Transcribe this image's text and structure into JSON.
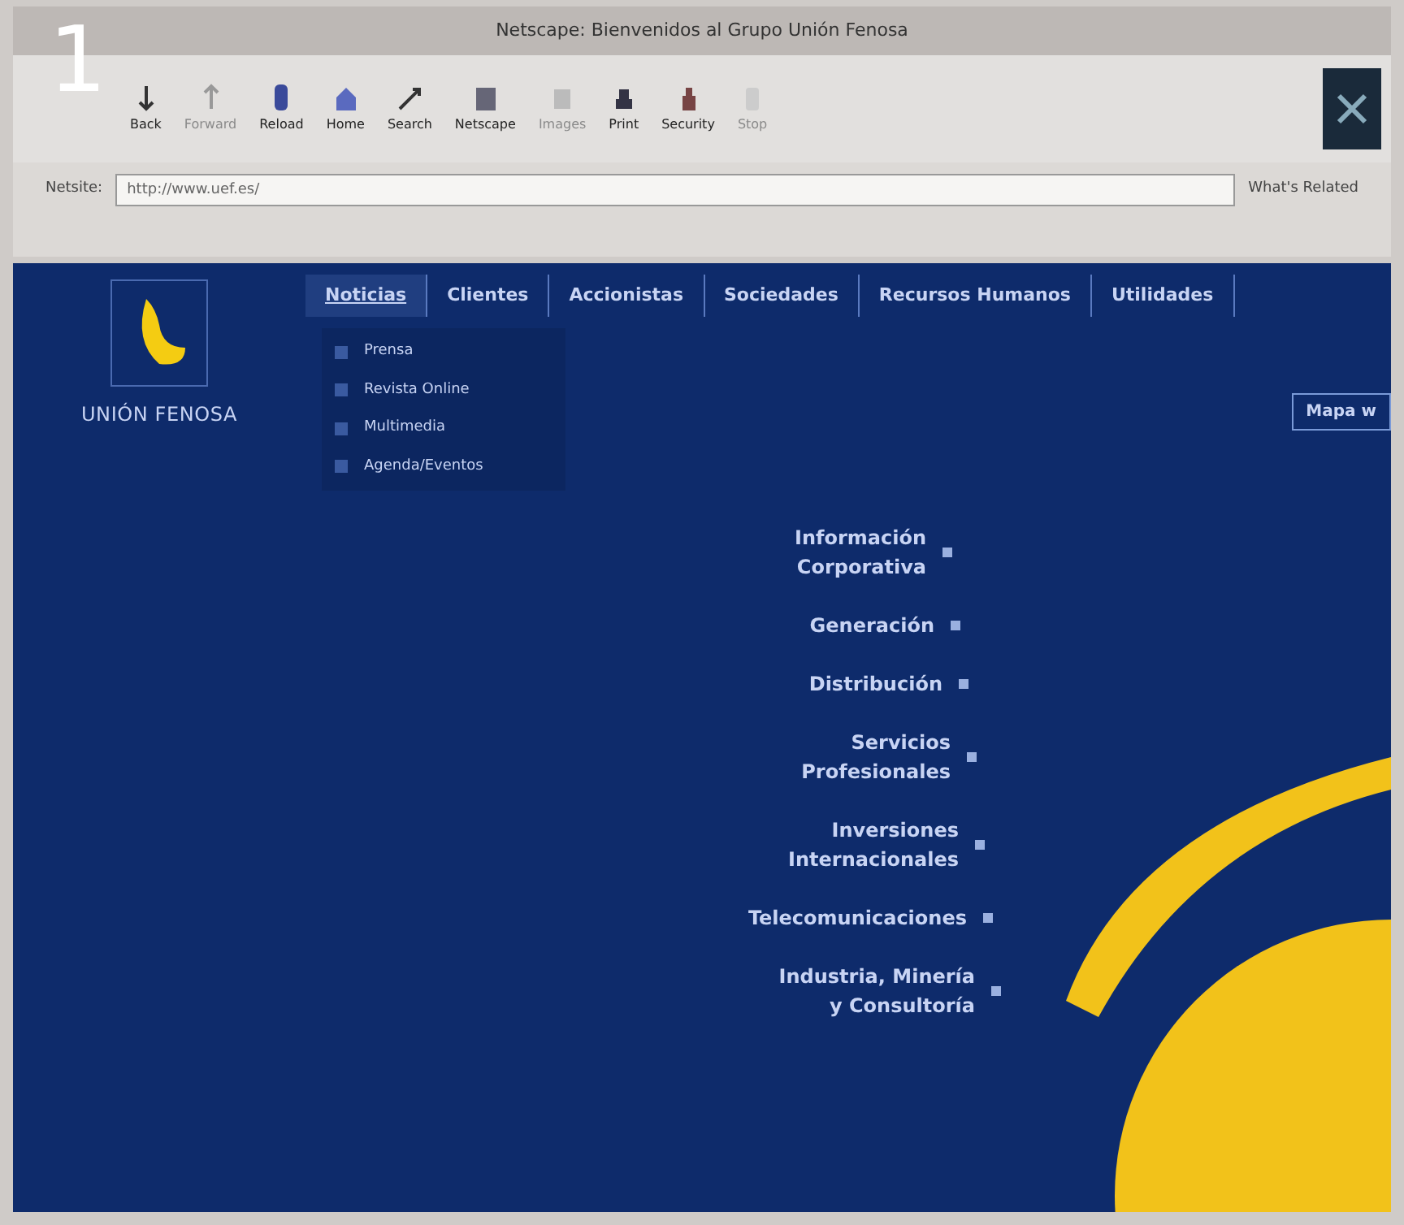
{
  "figure_label": "1",
  "window": {
    "title": "Netscape: Bienvenidos al Grupo Unión Fenosa"
  },
  "toolbar": [
    {
      "label": "Back",
      "disabled": false
    },
    {
      "label": "Forward",
      "disabled": true
    },
    {
      "label": "Reload",
      "disabled": false
    },
    {
      "label": "Home",
      "disabled": false
    },
    {
      "label": "Search",
      "disabled": false
    },
    {
      "label": "Netscape",
      "disabled": false
    },
    {
      "label": "Images",
      "disabled": true
    },
    {
      "label": "Print",
      "disabled": false
    },
    {
      "label": "Security",
      "disabled": false
    },
    {
      "label": "Stop",
      "disabled": true
    }
  ],
  "location": {
    "label": "Netsite:",
    "value": "http://www.uef.es/"
  },
  "whats_related": "What's Related",
  "site": {
    "logo_text": "UNIÓN FENOSA",
    "nav": [
      {
        "label": "Noticias",
        "selected": true
      },
      {
        "label": "Clientes",
        "selected": false
      },
      {
        "label": "Accionistas",
        "selected": false
      },
      {
        "label": "Sociedades",
        "selected": false
      },
      {
        "label": "Recursos Humanos",
        "selected": false
      },
      {
        "label": "Utilidades",
        "selected": false
      }
    ],
    "submenu": [
      "Prensa",
      "Revista Online",
      "Multimedia",
      "Agenda/Eventos"
    ],
    "side_button": "Mapa w",
    "sections": [
      [
        "Información",
        "Corporativa"
      ],
      [
        "Generación"
      ],
      [
        "Distribución"
      ],
      [
        "Servicios",
        "Profesionales"
      ],
      [
        "Inversiones",
        "Internacionales"
      ],
      [
        "Telecomunicaciones"
      ],
      [
        "Industria, Minería",
        "y Consultoría"
      ]
    ]
  }
}
